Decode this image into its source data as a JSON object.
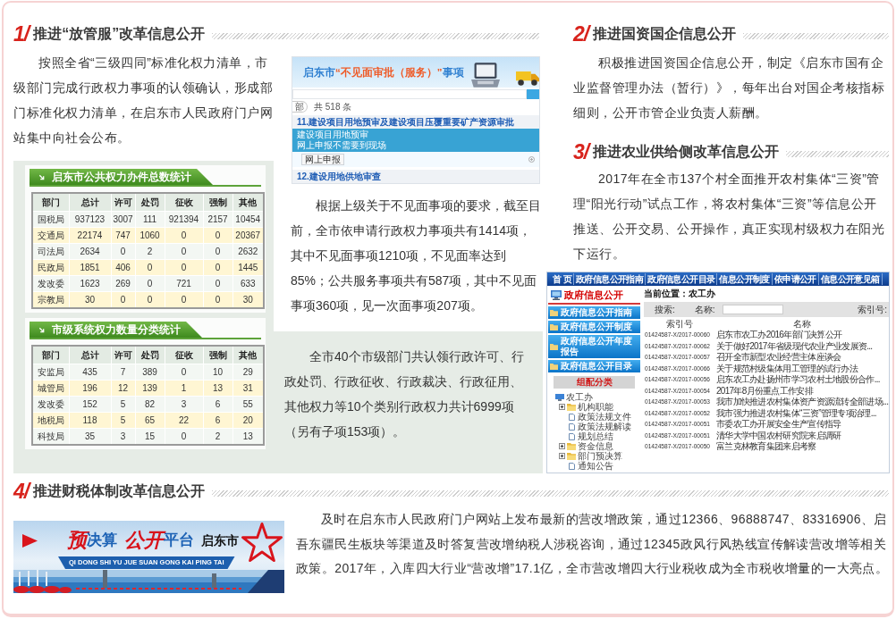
{
  "section_1": {
    "number": "1/",
    "title": "推进“放管服”改革信息公开",
    "intro": "按照全省“三级四同”标准化权力清单，市级部门完成行政权力事项的认领确认，形成部门标准化权力清单，在启东市人民政府门户网站集中向社会公布。",
    "approval_screenshot": {
      "title_parts": [
        {
          "text": "启东市",
          "emphasis": false
        },
        {
          "text": "“不见面审批（服务）”",
          "emphasis": true
        },
        {
          "text": "事项",
          "emphasis": false
        }
      ],
      "filter_chip": "部",
      "result_count": "共 518 条",
      "items": [
        {
          "title": "11.建设项目用地预审及建设项目压覆重要矿产资源审批",
          "details": [
            "建设项目用地预审",
            "网上申报不需要到现场"
          ],
          "action": "网上申报"
        },
        {
          "title": "12.建设用地供地审查"
        }
      ]
    },
    "stats_tables": [
      {
        "title": "启东市公共权力办件总数统计",
        "columns": [
          "部门",
          "总计",
          "许可",
          "处罚",
          "征收",
          "强制",
          "其他"
        ],
        "rows": [
          [
            "国税局",
            "937123",
            "3007",
            "111",
            "921394",
            "2157",
            "10454"
          ],
          [
            "交通局",
            "22174",
            "747",
            "1060",
            "0",
            "0",
            "20367"
          ],
          [
            "司法局",
            "2634",
            "0",
            "2",
            "0",
            "0",
            "2632"
          ],
          [
            "民政局",
            "1851",
            "406",
            "0",
            "0",
            "0",
            "1445"
          ],
          [
            "发改委",
            "1623",
            "269",
            "0",
            "721",
            "0",
            "633"
          ],
          [
            "宗教局",
            "30",
            "0",
            "0",
            "0",
            "0",
            "30"
          ]
        ]
      },
      {
        "title": "市级系统权力数量分类统计",
        "columns": [
          "部门",
          "总计",
          "许可",
          "处罚",
          "征收",
          "强制",
          "其他"
        ],
        "rows": [
          [
            "安监局",
            "435",
            "7",
            "389",
            "0",
            "10",
            "29"
          ],
          [
            "城管局",
            "196",
            "12",
            "139",
            "1",
            "13",
            "31"
          ],
          [
            "发改委",
            "152",
            "5",
            "82",
            "3",
            "6",
            "55"
          ],
          [
            "地税局",
            "118",
            "5",
            "65",
            "22",
            "6",
            "20"
          ],
          [
            "科技局",
            "35",
            "3",
            "15",
            "0",
            "2",
            "13"
          ]
        ]
      }
    ],
    "note_1": "根据上级关于不见面事项的要求，截至目前，全市依申请行政权力事项共有1414项，其中不见面事项1210项，不见面率达到85%；公共服务事项共有587项，其中不见面事项360项，见一次面事项207项。",
    "note_2": "全市40个市级部门共认领行政许可、行政处罚、行政征收、行政裁决、行政征用、其他权力等10个类别行政权力共计6999项（另有子项153项）。"
  },
  "section_2": {
    "number": "2/",
    "title": "推进国资国企信息公开",
    "paragraph": "积极推进国资国企信息公开，制定《启东市国有企业监督管理办法（暂行）》，每年出台对国企考核指标细则，公开市管企业负责人薪酬。"
  },
  "section_3": {
    "number": "3/",
    "title": "推进农业供给侧改革信息公开",
    "paragraph": "2017年在全市137个村全面推开农村集体“三资”管理“阳光行动”试点工作，将农村集体“三资”等信息公开推送、公开交易、公开操作，真正实现村级权力在阳光下运行。",
    "portal_screenshot": {
      "nav": [
        "首 页",
        "政府信息公开指南",
        "政府信息公开目录",
        "信息公开制度",
        "依申请公开",
        "信息公开意见箱"
      ],
      "sidebar_title": "政府信息公开",
      "sidebar_links": [
        "政府信息公开指南",
        "政府信息公开制度",
        "政府信息公开年度报告",
        "政府信息公开目录"
      ],
      "category_tab": "组配分类",
      "tree": {
        "label": "农工办",
        "children": [
          {
            "label": "机构职能",
            "kind": "folder",
            "expanded": false
          },
          {
            "label": "政策法规文件",
            "kind": "page"
          },
          {
            "label": "政策法规解读",
            "kind": "page"
          },
          {
            "label": "规划总结",
            "kind": "page"
          },
          {
            "label": "资金信息",
            "kind": "folder",
            "expanded": false
          },
          {
            "label": "部门预决算",
            "kind": "folder",
            "expanded": false
          },
          {
            "label": "通知公告",
            "kind": "page"
          }
        ]
      },
      "breadcrumb": "当前位置：农工办",
      "search_label": "搜索:",
      "name_label": "名称:",
      "index_label": "索引号:",
      "columns": [
        "索引号",
        "名称"
      ],
      "rows": [
        {
          "index": "01424587-X/2017-00060",
          "name": "启东市农工办2016年部门决算公开"
        },
        {
          "index": "01424587-X/2017-00062",
          "name": "关于做好2017年省级现代农业产业发展资..."
        },
        {
          "index": "01424587-X/2017-00057",
          "name": "召开全市新型农业经营主体座谈会"
        },
        {
          "index": "01424587-X/2017-00066",
          "name": "关于规范村级集体用工管理的试行办法"
        },
        {
          "index": "01424587-X/2017-00056",
          "name": "启东农工办赴扬州市学习农村土地股份合作..."
        },
        {
          "index": "01424587-X/2017-00054",
          "name": "2017年8月份重点工作安排"
        },
        {
          "index": "01424587-X/2017-00053",
          "name": "我市加快推进农村集体资产资源流转全部进场..."
        },
        {
          "index": "01424587-X/2017-00052",
          "name": "我市强力推进农村集体“三资”管理专项治理..."
        },
        {
          "index": "01424587-X/2017-00051",
          "name": "市委农工办开展安全生产宣传指导"
        },
        {
          "index": "01424587-X/2017-00051",
          "name": "清华大学中国农村研究院来启调研"
        },
        {
          "index": "01424587-X/2017-00050",
          "name": "富兰克林教育集团来启考察"
        }
      ]
    }
  },
  "section_4": {
    "number": "4/",
    "title": "推进财税体制改革信息公开",
    "banner": {
      "title_words": [
        {
          "parts": [
            {
              "text": "预",
              "emphasis": true
            },
            {
              "text": "决算",
              "emphasis": false
            }
          ]
        },
        {
          "parts": [
            {
              "text": "公开",
              "emphasis": true
            },
            {
              "text": "平台",
              "emphasis": false
            }
          ]
        }
      ],
      "city": "启东市",
      "pinyin": "QI DONG SHI YU JUE SUAN GONG KAI PING TAI"
    },
    "paragraph": "及时在启东市人民政府门户网站上发布最新的营改增政策，通过12366、96888747、83316906、启吾东疆民生板块等渠道及时答复营改增纳税人涉税咨询，通过12345政风行风热线宣传解读营改增等相关政策。2017年，入库四大行业“营改增”17.1亿，全市营改增四大行业税收成为全市税收增量的一大亮点。"
  }
}
